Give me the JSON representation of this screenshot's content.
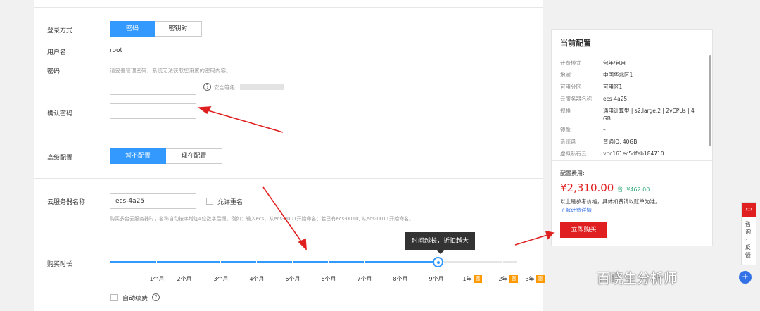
{
  "login": {
    "label": "登录方式",
    "options": [
      "密码",
      "密钥对"
    ],
    "selected": "密码"
  },
  "username": {
    "label": "用户名",
    "value": "root"
  },
  "password": {
    "label": "密码",
    "hint": "请妥善管理密码，系统无法获取您设置的密码内容。",
    "value": "",
    "strength_label": "安全等级:"
  },
  "confirm": {
    "label": "确认密码",
    "value": ""
  },
  "advanced": {
    "label": "高级配置",
    "options": [
      "暂不配置",
      "现在配置"
    ],
    "selected": "暂不配置"
  },
  "server_name": {
    "label": "云服务器名称",
    "value": "ecs-4a25",
    "allow_dup_label": "允许重名",
    "hint": "购买多台云服务器时，名称自动按序增加4位数字后缀。例如：输入ecs，从ecs-0001开始命名；若已有ecs-0010, 从ecs-0011开始命名。"
  },
  "duration": {
    "label": "购买时长",
    "tooltip": "时间越长，折扣越大",
    "marks": [
      "1个月",
      "2个月",
      "3个月",
      "4个月",
      "5个月",
      "6个月",
      "7个月",
      "8个月",
      "9个月",
      "1年",
      "2年",
      "3年"
    ],
    "selected": "1年",
    "discount_badge": "惠",
    "auto_renew_label": "自动续费",
    "help_icon": "?"
  },
  "config": {
    "title": "当前配置",
    "rows": [
      {
        "key": "计费模式",
        "value": "包年/包月"
      },
      {
        "key": "地域",
        "value": "中国华北区1"
      },
      {
        "key": "可用分区",
        "value": "可用区1"
      },
      {
        "key": "云服务器名称",
        "value": "ecs-4a25"
      },
      {
        "key": "规格",
        "value": "通用计算型 | s2.large.2 | 2vCPUs | 4 GB"
      },
      {
        "key": "镜像",
        "value": "–"
      },
      {
        "key": "系统盘",
        "value": "普通IO, 40GB"
      },
      {
        "key": "虚拟私有云",
        "value": "vpc161ec5dfeb184710"
      }
    ],
    "fee_label": "配置费用:",
    "price": "¥2,310.00",
    "save": "省: ¥462.00",
    "note": "以上是参考价格，具体扣费请以账单为准。",
    "link": "了解计费详情",
    "buy_label": "立即购买"
  },
  "feedback": {
    "icon": "▭",
    "text": "咨询·反馈",
    "plus": "+"
  },
  "watermark": "百晓生分析师",
  "colors": {
    "primary": "#3399ff",
    "danger": "#e02020",
    "success": "#2aa876",
    "badge": "#ff9900"
  }
}
